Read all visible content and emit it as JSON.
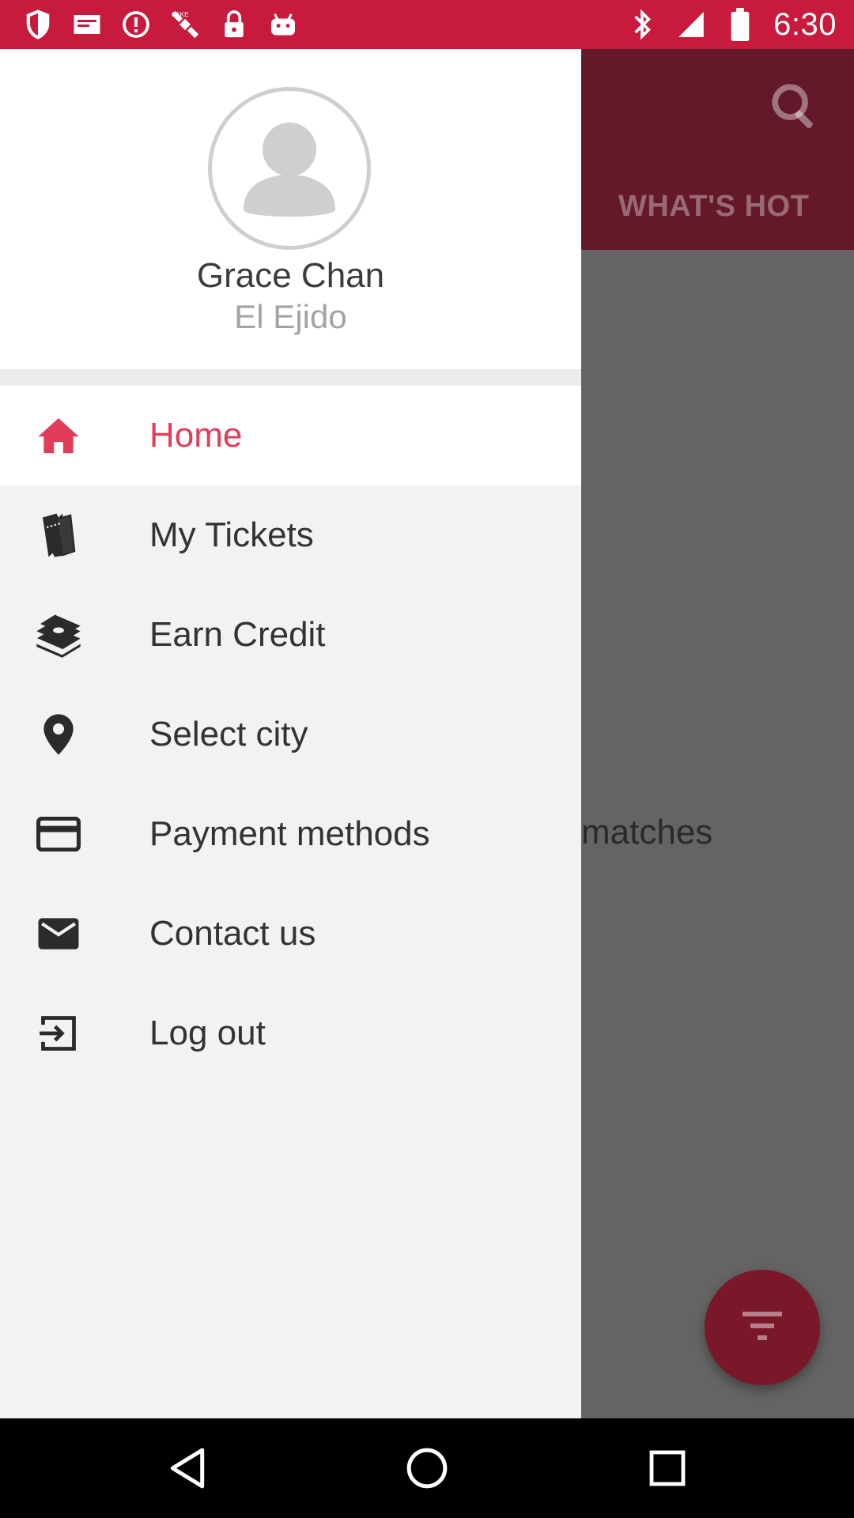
{
  "status_bar": {
    "time": "6:30",
    "left_icons": [
      "shield-icon",
      "mail-icon",
      "alert-icon",
      "fake-gps-icon",
      "lock-icon",
      "android-icon"
    ],
    "right_icons": [
      "bluetooth-icon",
      "signal-icon",
      "battery-icon"
    ]
  },
  "app": {
    "tab_label": "WHAT'S HOT",
    "empty_text": "matches",
    "search_icon": "search-icon",
    "fab_icon": "filter-icon",
    "colors": {
      "toolbar": "#63192a",
      "overlay": "#646464",
      "fab": "#7a1728"
    }
  },
  "drawer": {
    "user": {
      "name": "Grace Chan",
      "city": "El Ejido",
      "avatar_icon": "avatar-placeholder-icon"
    },
    "items": [
      {
        "label": "Home",
        "icon": "home-icon",
        "active": true
      },
      {
        "label": "My Tickets",
        "icon": "tickets-icon",
        "active": false
      },
      {
        "label": "Earn Credit",
        "icon": "money-stack-icon",
        "active": false
      },
      {
        "label": "Select city",
        "icon": "location-pin-icon",
        "active": false
      },
      {
        "label": "Payment methods",
        "icon": "credit-card-icon",
        "active": false
      },
      {
        "label": "Contact us",
        "icon": "envelope-icon",
        "active": false
      },
      {
        "label": "Log out",
        "icon": "logout-icon",
        "active": false
      }
    ],
    "colors": {
      "active": "#e23d58",
      "accent": "#c81a3d"
    }
  },
  "nav_bar": {
    "buttons": [
      "back-icon",
      "home-circle-icon",
      "recents-icon"
    ]
  }
}
